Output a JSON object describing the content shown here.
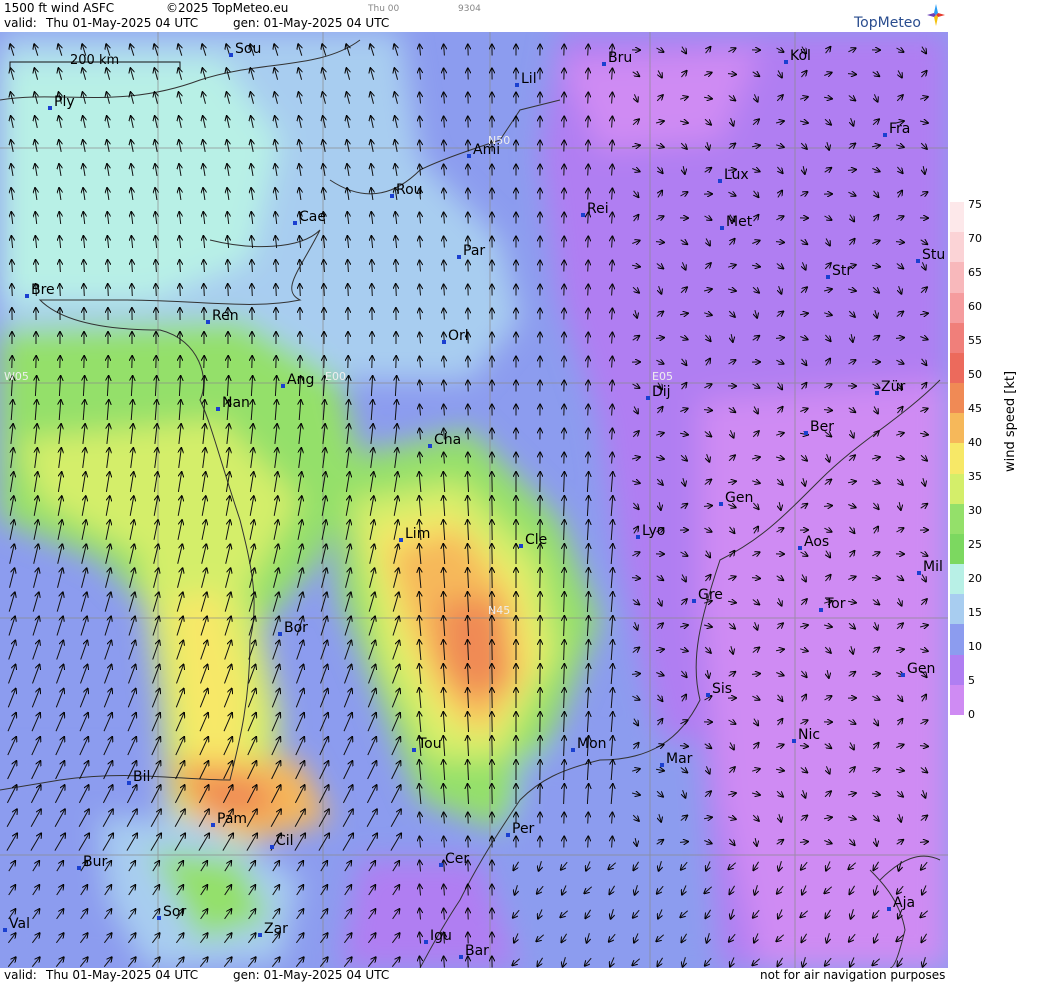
{
  "header": {
    "product": "1500 ft wind ASFC",
    "copyright": "©2025 TopMeteo.eu",
    "valid_label": "valid:",
    "valid_time": "Thu  01-May-2025  04 UTC",
    "gen": "gen:  01-May-2025 04 UTC",
    "small_time": "Thu 00",
    "small_code": "9304",
    "logo": "TopMeteo"
  },
  "footer": {
    "valid_label": "valid:",
    "valid_time": "Thu  01-May-2025  04 UTC",
    "gen": "gen:  01-May-2025 04 UTC",
    "disclaimer": "not for air navigation purposes"
  },
  "scale": {
    "label": "200 km"
  },
  "grid_labels": {
    "n50": "N50",
    "n45": "N45",
    "w05": "W05",
    "e00": "E00",
    "e05": "E05"
  },
  "cities": [
    {
      "name": "Sou"
    },
    {
      "name": "Ply"
    },
    {
      "name": "Lil"
    },
    {
      "name": "Bru"
    },
    {
      "name": "Köl"
    },
    {
      "name": "Ami"
    },
    {
      "name": "Fra"
    },
    {
      "name": "Rou"
    },
    {
      "name": "Lux"
    },
    {
      "name": "Cae"
    },
    {
      "name": "Rei"
    },
    {
      "name": "Met"
    },
    {
      "name": "Par"
    },
    {
      "name": "Bre"
    },
    {
      "name": "Str"
    },
    {
      "name": "Stu"
    },
    {
      "name": "Ren"
    },
    {
      "name": "Orl"
    },
    {
      "name": "Ang"
    },
    {
      "name": "Nan"
    },
    {
      "name": "Dij"
    },
    {
      "name": "Zür"
    },
    {
      "name": "Ber"
    },
    {
      "name": "Cha"
    },
    {
      "name": "Gen"
    },
    {
      "name": "Lim"
    },
    {
      "name": "Cle"
    },
    {
      "name": "Lyo"
    },
    {
      "name": "Aos"
    },
    {
      "name": "Mil"
    },
    {
      "name": "Gre"
    },
    {
      "name": "Tor"
    },
    {
      "name": "Bor"
    },
    {
      "name": "Gen"
    },
    {
      "name": "Sis"
    },
    {
      "name": "Tou"
    },
    {
      "name": "Mon"
    },
    {
      "name": "Nic"
    },
    {
      "name": "Mar"
    },
    {
      "name": "Bil"
    },
    {
      "name": "Per"
    },
    {
      "name": "Pam"
    },
    {
      "name": "Cil"
    },
    {
      "name": "Bur"
    },
    {
      "name": "Cer"
    },
    {
      "name": "Sor"
    },
    {
      "name": "Aja"
    },
    {
      "name": "Val"
    },
    {
      "name": "Zar"
    },
    {
      "name": "Igu"
    },
    {
      "name": "Bar"
    }
  ],
  "legend": {
    "title": "wind speed [kt]",
    "ticks": [
      "75",
      "70",
      "65",
      "60",
      "55",
      "50",
      "45",
      "40",
      "35",
      "30",
      "25",
      "20",
      "15",
      "10",
      "5",
      "0"
    ],
    "colors": [
      "#fde8ea",
      "#fbd3d6",
      "#f8b8bb",
      "#f59c9e",
      "#f07f7a",
      "#ec6a5c",
      "#f08a55",
      "#f6b85a",
      "#f7e867",
      "#d4ee6a",
      "#94e06a",
      "#b8f0e6",
      "#a8cdf0",
      "#8c9cef",
      "#b07ef2",
      "#cf8bf3"
    ],
    "fine_colors": [
      "#fde8ea",
      "#fbd3d6",
      "#f8b8bb",
      "#f59c9e",
      "#f07f7a",
      "#ec6a5c",
      "#f08a55",
      "#f6b85a",
      "#f7e867",
      "#d4ee6a",
      "#94e06a",
      "#7cd860",
      "#b8f0e6",
      "#a8cdf0",
      "#8c9cef",
      "#b07ef2",
      "#cf8bf3"
    ]
  },
  "colors": {
    "calm": "#cf8bf3",
    "light": "#8c9cef",
    "moderate": "#a8cdf0",
    "fresh": "#b8f0e6",
    "strong": "#94e06a",
    "higher": "#d4ee6a",
    "yellow": "#f7e867",
    "orange": "#f6b85a",
    "red": "#ec6a5c",
    "city_marker": "#1a3fd0"
  }
}
